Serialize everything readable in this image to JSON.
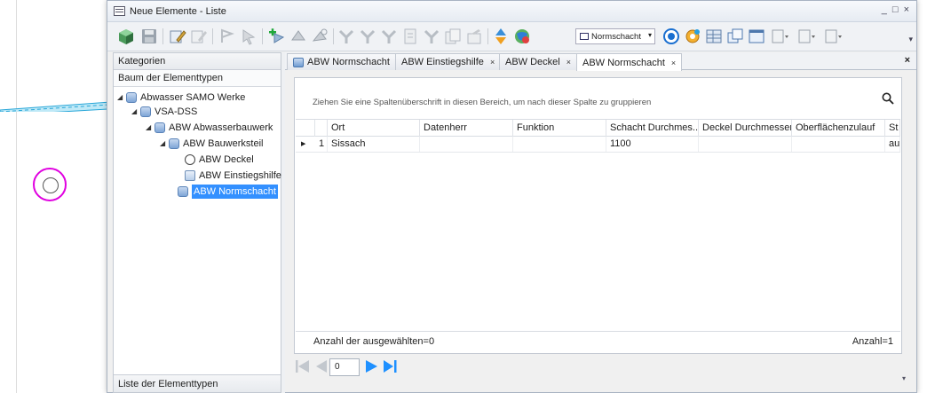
{
  "window": {
    "title": "Neue Elemente - Liste",
    "controls": [
      "_",
      "□",
      "×"
    ]
  },
  "toolbar": {
    "combo_value": "Normschacht",
    "overflow": "▾"
  },
  "left_panel": {
    "header": "Kategorien",
    "subheader": "Baum der Elementtypen",
    "tree": [
      {
        "label": "Abwasser SAMO Werke",
        "expander": "◢"
      },
      {
        "label": "VSA-DSS",
        "expander": "◢"
      },
      {
        "label": "ABW Abwasserbauwerk",
        "expander": "◢"
      },
      {
        "label": "ABW Bauwerksteil",
        "expander": "◢"
      },
      {
        "label": "ABW Deckel"
      },
      {
        "label": "ABW Einstiegshilfe"
      },
      {
        "label": "ABW Normschacht"
      }
    ],
    "footer": "Liste der Elementtypen"
  },
  "tabs": [
    {
      "label": "ABW Normschacht",
      "closable": false
    },
    {
      "label": "ABW Einstiegshilfe",
      "close": "×"
    },
    {
      "label": "ABW Deckel",
      "close": "×"
    },
    {
      "label": "ABW Normschacht",
      "close": "×"
    }
  ],
  "tabstrip_close": "×",
  "grid": {
    "group_hint": "Ziehen Sie eine Spaltenüberschrift in diesen Bereich, um nach dieser Spalte zu gruppieren",
    "columns": [
      "Ort",
      "Datenherr",
      "Funktion",
      "Schacht Durchmes...",
      "Deckel Durchmesser",
      "Oberflächenzulauf",
      "St"
    ],
    "rows": [
      {
        "marker": "▶",
        "num": "1",
        "cells": [
          "Sissach",
          "",
          "",
          "1100",
          "",
          "",
          "au"
        ]
      }
    ],
    "selected_count": "Anzahl der ausgewählten=0",
    "total_count": "Anzahl=1"
  },
  "pager": {
    "page": "0"
  },
  "colors": {
    "accent": "#3390ff",
    "pager_blue": "#1e90ff",
    "highlight_circle": "#e000e0"
  }
}
